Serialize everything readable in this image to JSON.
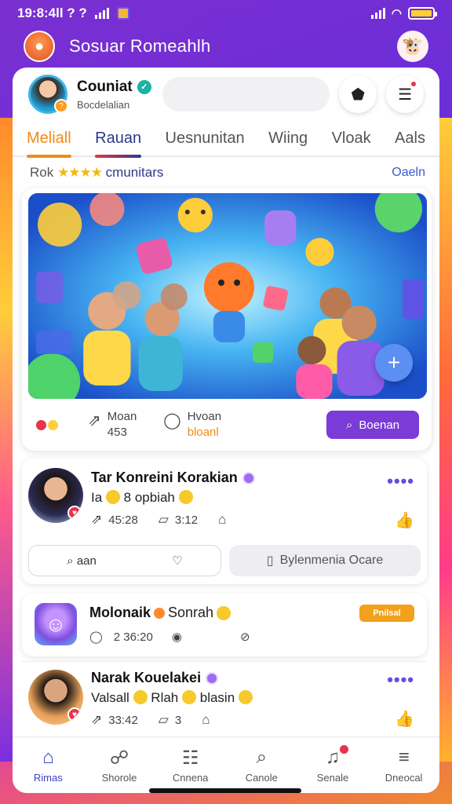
{
  "status_bar": {
    "time": "19:8:4ll ? ?"
  },
  "app": {
    "title": "Sosuar Romeahlh"
  },
  "profile": {
    "name": "Couniat",
    "subtitle": "Bocdelalian",
    "search_placeholder": ""
  },
  "tabs": [
    {
      "label": "Meliall"
    },
    {
      "label": "Rauan"
    },
    {
      "label": "Uesnunitan"
    },
    {
      "label": "Wiing"
    },
    {
      "label": "Vloak"
    },
    {
      "label": "Aals"
    }
  ],
  "section": {
    "prefix": "Rok",
    "stars": "★★★★",
    "label": "cmunitars",
    "link": "Oaeln"
  },
  "featured": {
    "meta1_line1": "Moan",
    "meta1_line2": "453",
    "meta2_line1": "Hvoan",
    "meta2_line2": "bloanl",
    "button_label": "Boenan"
  },
  "post1": {
    "title": "Tar Konreini Korakian",
    "subtitle_a": "Ia",
    "subtitle_b": "8 opbiah",
    "stat1": "45:28",
    "stat2": "3:12",
    "reply_text": "aan",
    "secondary_label": "Bylenmenia Ocare"
  },
  "post2": {
    "title": "Molonaik",
    "title_tail": "Sonrah",
    "stat": "2 36:20",
    "badge": "Pnilsal"
  },
  "post3": {
    "title": "Narak Kouelakei",
    "subtitle_a": "Valsall",
    "subtitle_b": "Rlah",
    "subtitle_c": "blasin",
    "stat1": "33:42",
    "stat2": "3"
  },
  "bottom_nav": [
    {
      "label": "Rimas"
    },
    {
      "label": "Shorole"
    },
    {
      "label": "Cnnena"
    },
    {
      "label": "Canole"
    },
    {
      "label": "Senale"
    },
    {
      "label": "Dneocal"
    }
  ],
  "colors": {
    "accent_purple": "#7a3bd6",
    "accent_orange": "#f08a1a",
    "nav_active": "#3b3fc9"
  }
}
